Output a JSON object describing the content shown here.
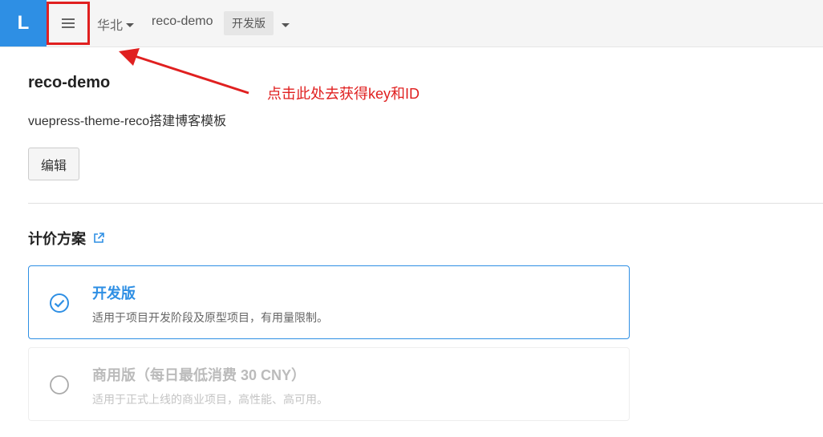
{
  "topbar": {
    "logo_letter": "L",
    "region": "华北",
    "app_name": "reco-demo",
    "edition_badge": "开发版"
  },
  "annotation": {
    "text": "点击此处去获得key和ID",
    "color": "#e02020"
  },
  "app": {
    "title": "reco-demo",
    "description": "vuepress-theme-reco搭建博客模板",
    "edit_label": "编辑"
  },
  "pricing": {
    "section_title": "计价方案",
    "plans": [
      {
        "name": "开发版",
        "note": "适用于项目开发阶段及原型项目，有用量限制。",
        "selected": true
      },
      {
        "name": "商用版（每日最低消费 30 CNY）",
        "note": "适用于正式上线的商业项目，高性能、高可用。",
        "selected": false
      }
    ]
  },
  "colors": {
    "accent": "#2e8fe4",
    "annotation": "#e02020"
  },
  "icons": {
    "menu": "hamburger-icon",
    "dropdown": "caret-down-icon",
    "external": "external-link-icon",
    "selected": "check-circle-icon",
    "unselected": "radio-circle-icon"
  }
}
